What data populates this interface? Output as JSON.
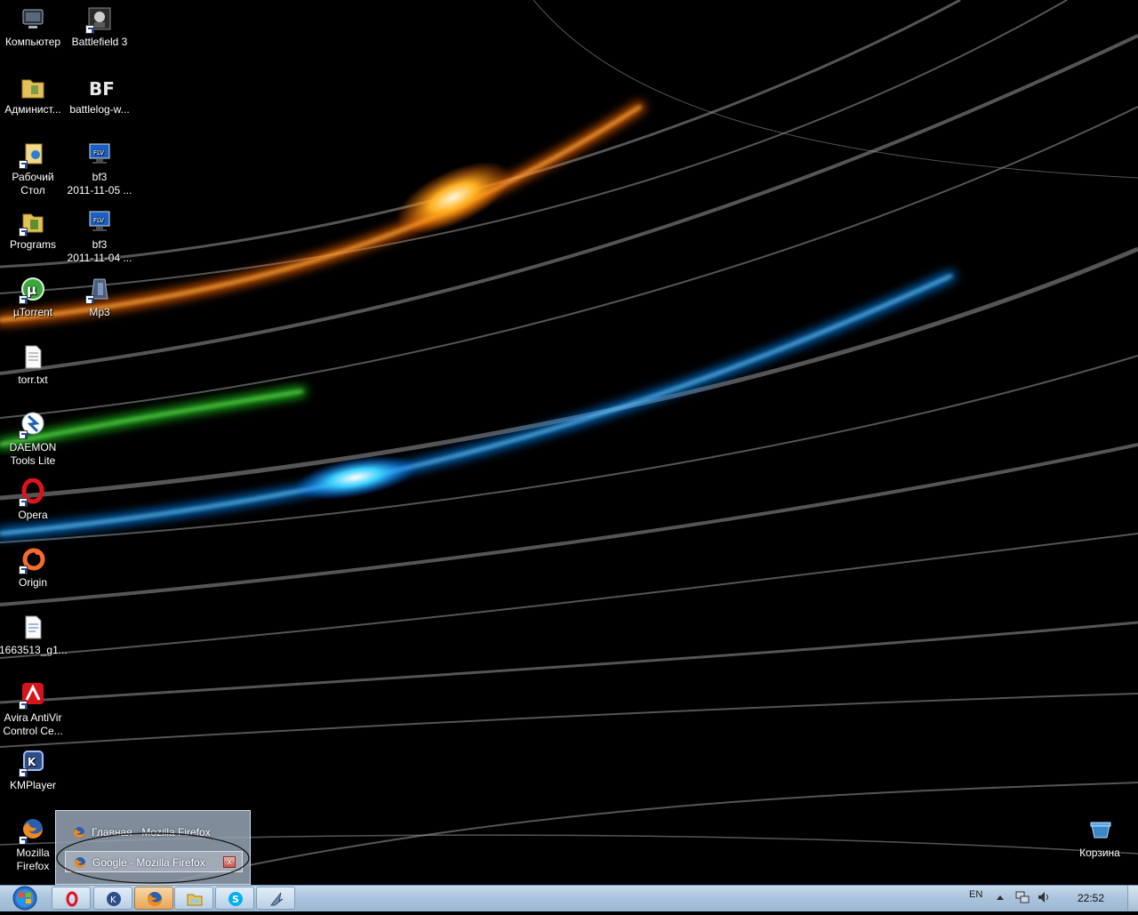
{
  "desktop": {
    "icons": [
      {
        "label": "Компьютер",
        "icon": "computer-icon"
      },
      {
        "label": "Battlefield 3",
        "icon": "battlefield-icon"
      },
      {
        "label": "Админист...",
        "icon": "user-folder-icon"
      },
      {
        "label": "battlelog-w...",
        "icon": "bf-logo-icon"
      },
      {
        "label": "Рабочий\nСтол",
        "icon": "desktop-shortcut-icon"
      },
      {
        "label": "bf3\n2011-11-05 ...",
        "icon": "flv-video-icon"
      },
      {
        "label": "Programs",
        "icon": "programs-folder-icon"
      },
      {
        "label": "bf3\n2011-11-04 ...",
        "icon": "flv-video-icon"
      },
      {
        "label": "µTorrent",
        "icon": "utorrent-icon"
      },
      {
        "label": "Mp3",
        "icon": "mp3-folder-icon"
      },
      {
        "label": "torr.txt",
        "icon": "text-file-icon"
      },
      {
        "label": "DAEMON\nTools Lite",
        "icon": "daemon-tools-icon"
      },
      {
        "label": "Opera",
        "icon": "opera-icon"
      },
      {
        "label": "Origin",
        "icon": "origin-icon"
      },
      {
        "label": "1663513_g1...",
        "icon": "document-icon"
      },
      {
        "label": "Avira AntiVir\nControl Ce...",
        "icon": "avira-icon"
      },
      {
        "label": "KMPlayer",
        "icon": "kmplayer-icon"
      },
      {
        "label": "Mozilla\nFirefox",
        "icon": "firefox-icon"
      },
      {
        "label": "Корзина",
        "icon": "recycle-bin-icon"
      }
    ]
  },
  "taskbar_popup": {
    "items": [
      {
        "title": "Главная - Mozilla Firefox"
      },
      {
        "title": "Google - Mozilla Firefox"
      }
    ],
    "close_glyph": "x"
  },
  "taskbar": {
    "start": "start-orb-icon",
    "buttons": [
      "opera-icon",
      "kmplayer-icon",
      "firefox-icon",
      "explorer-folder-icon",
      "skype-icon",
      "feather-app-icon"
    ],
    "active_button": "firefox-icon"
  },
  "tray": {
    "language": "EN",
    "clock": "22:52"
  }
}
